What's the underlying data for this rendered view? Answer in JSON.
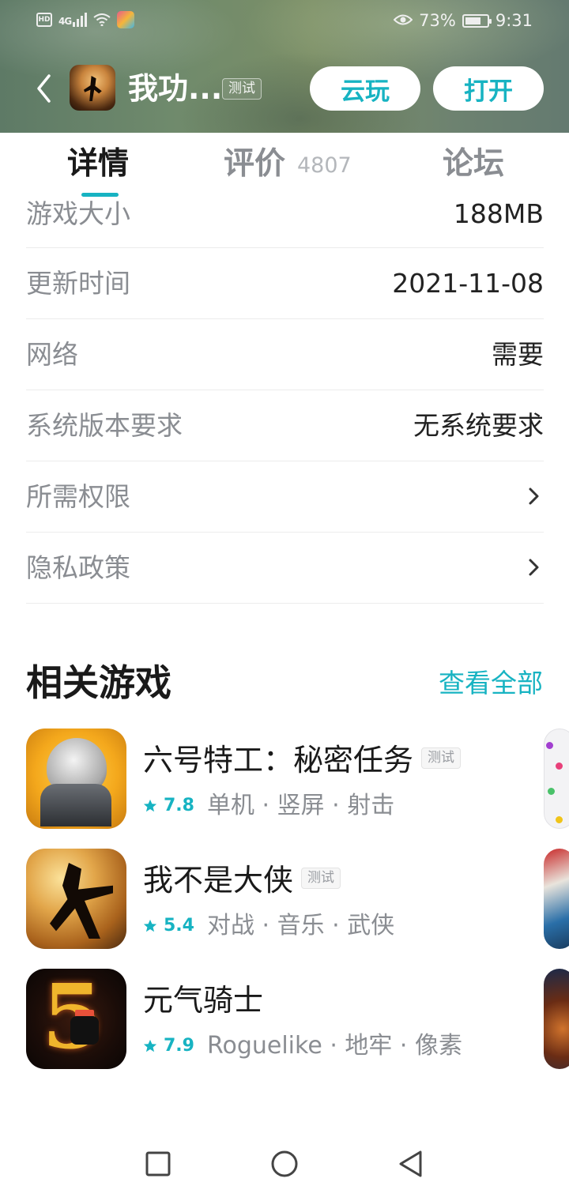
{
  "status_bar": {
    "hd": "HD",
    "signal": "4G",
    "battery_percent": "73%",
    "battery_level": 0.73,
    "time": "9:31",
    "icons": [
      "hd-icon",
      "signal-icon",
      "wifi-icon",
      "notification-app-icon",
      "eye-comfort-icon",
      "battery-icon"
    ]
  },
  "header": {
    "app_title": "我功...",
    "test_tag": "测试",
    "cloud_play_label": "云玩",
    "open_label": "打开"
  },
  "tabs": [
    {
      "label": "详情",
      "active": true
    },
    {
      "label": "评价",
      "count": "4807",
      "active": false
    },
    {
      "label": "论坛",
      "active": false
    }
  ],
  "info": [
    {
      "label": "游戏大小",
      "value": "188MB"
    },
    {
      "label": "更新时间",
      "value": "2021-11-08"
    },
    {
      "label": "网络",
      "value": "需要"
    },
    {
      "label": "系统版本要求",
      "value": "无系统要求"
    },
    {
      "label": "所需权限",
      "value": ""
    },
    {
      "label": "隐私政策",
      "value": ""
    }
  ],
  "related": {
    "title": "相关游戏",
    "see_all": "查看全部",
    "games": [
      {
        "name": "六号特工：秘密任务",
        "tag": "测试",
        "score": "7.8",
        "tags": "单机 · 竖屏 · 射击"
      },
      {
        "name": "我不是大侠",
        "tag": "测试",
        "score": "5.4",
        "tags": "对战 · 音乐 · 武侠"
      },
      {
        "name": "元气骑士",
        "tag": "",
        "score": "7.9",
        "tags": "Roguelike · 地牢 · 像素"
      }
    ]
  },
  "colors": {
    "accent": "#17b3c2",
    "label_gray": "#8a8d92",
    "text": "#1a1a1a"
  }
}
